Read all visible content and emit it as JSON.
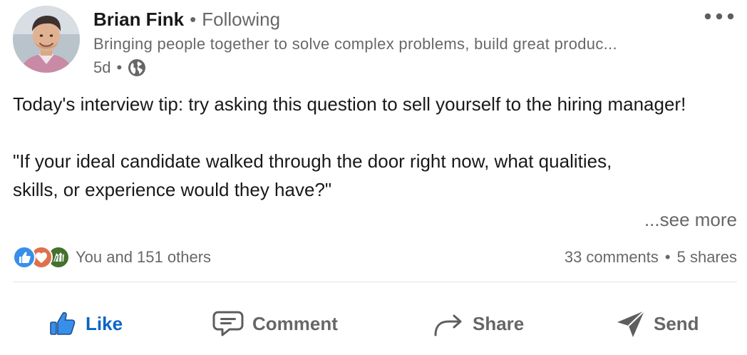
{
  "author": {
    "name": "Brian Fink",
    "separator": "•",
    "follow_status": "Following",
    "headline": "Bringing people together to solve complex problems, build great produc...",
    "time_ago": "5d",
    "meta_separator": "•",
    "visibility_icon": "globe-icon"
  },
  "more_menu_icon": "more-horizontal-icon",
  "post": {
    "line1": "Today's interview tip: try asking this question to sell yourself to the hiring manager!",
    "line2": "\"If your ideal candidate walked through the door right now, what qualities, skills, or experience would they have?\"",
    "see_more": "...see more"
  },
  "social": {
    "reaction_icons": [
      "like-reaction-icon",
      "love-reaction-icon",
      "celebrate-reaction-icon"
    ],
    "reactions_text": "You and 151 others",
    "comments": "33 comments",
    "separator": "•",
    "shares": "5 shares"
  },
  "actions": {
    "like": "Like",
    "comment": "Comment",
    "share": "Share",
    "send": "Send"
  },
  "colors": {
    "brand_blue": "#0a66c2",
    "secondary_text": "#666666",
    "primary_text": "#191919",
    "love_red": "#df704d",
    "celebrate_green": "#44712e"
  }
}
